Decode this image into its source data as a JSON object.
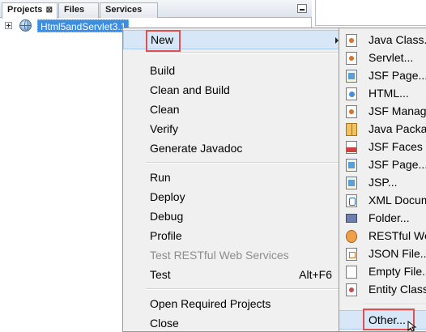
{
  "panel": {
    "tabs": [
      {
        "label": "Projects",
        "close": "⊠"
      },
      {
        "label": "Files"
      },
      {
        "label": "Services"
      }
    ],
    "project": {
      "name": "Html5andServlet3.1"
    }
  },
  "context_menu": {
    "items": [
      {
        "label": "New",
        "has_submenu": true
      },
      {
        "label": "Build"
      },
      {
        "label": "Clean and Build"
      },
      {
        "label": "Clean"
      },
      {
        "label": "Verify"
      },
      {
        "label": "Generate Javadoc"
      },
      {
        "label": "Run"
      },
      {
        "label": "Deploy"
      },
      {
        "label": "Debug"
      },
      {
        "label": "Profile"
      },
      {
        "label": "Test RESTful Web Services",
        "disabled": true
      },
      {
        "label": "Test",
        "accelerator": "Alt+F6"
      },
      {
        "label": "Open Required Projects"
      },
      {
        "label": "Close"
      }
    ]
  },
  "submenu": {
    "items": [
      {
        "label": "Java Class...",
        "icon": "java-class-icon"
      },
      {
        "label": "Servlet...",
        "icon": "servlet-icon"
      },
      {
        "label": "JSF Page...",
        "icon": "jsf-page-icon"
      },
      {
        "label": "HTML...",
        "icon": "html-file-icon"
      },
      {
        "label": "JSF Managed Bean...",
        "icon": "managed-bean-icon"
      },
      {
        "label": "Java Package...",
        "icon": "package-icon"
      },
      {
        "label": "JSF Faces Configuration...",
        "icon": "faces-config-icon"
      },
      {
        "label": "JSF Page...",
        "icon": "jsf-page-icon"
      },
      {
        "label": "JSP...",
        "icon": "jsp-icon"
      },
      {
        "label": "XML Document...",
        "icon": "xml-document-icon"
      },
      {
        "label": "Folder...",
        "icon": "folder-icon"
      },
      {
        "label": "RESTful Web Services...",
        "icon": "restful-icon"
      },
      {
        "label": "JSON File...",
        "icon": "json-file-icon"
      },
      {
        "label": "Empty File...",
        "icon": "empty-file-icon"
      },
      {
        "label": "Entity Class...",
        "icon": "entity-class-icon"
      },
      {
        "label": "Other...",
        "icon": ""
      }
    ]
  }
}
